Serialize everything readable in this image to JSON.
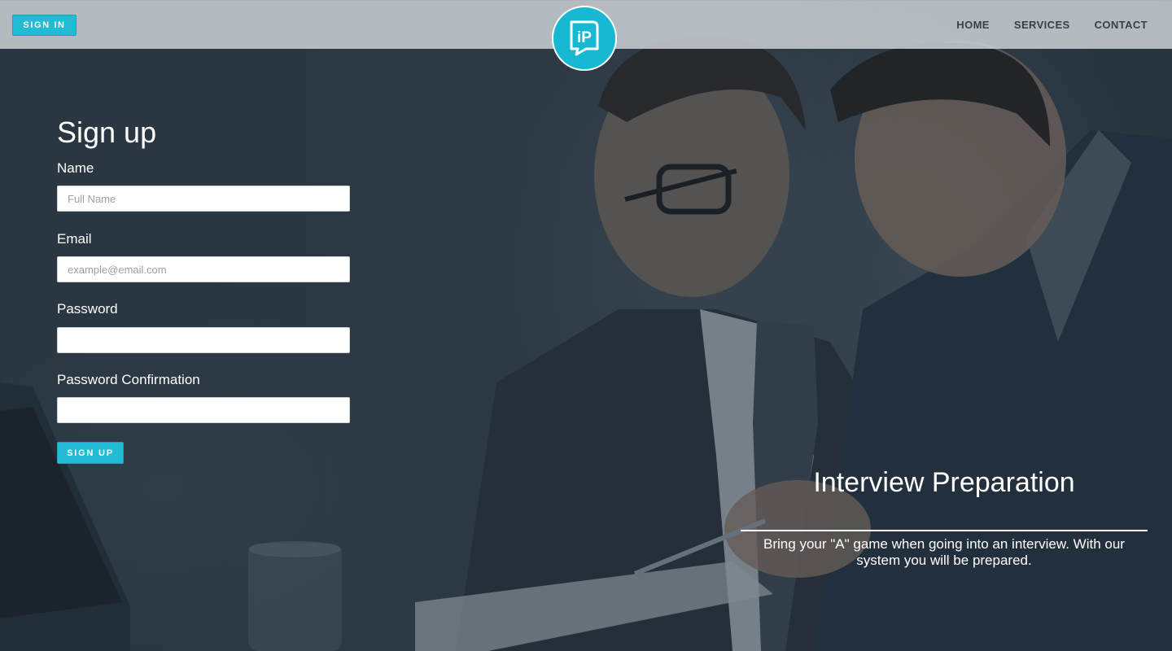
{
  "header": {
    "signin_label": "SIGN IN",
    "logo_text": "iP",
    "nav": [
      {
        "label": "HOME"
      },
      {
        "label": "SERVICES"
      },
      {
        "label": "CONTACT"
      }
    ]
  },
  "form": {
    "title": "Sign up",
    "fields": [
      {
        "label": "Name",
        "placeholder": "Full Name",
        "value": ""
      },
      {
        "label": "Email",
        "placeholder": "example@email.com",
        "value": ""
      },
      {
        "label": "Password",
        "placeholder": "",
        "value": ""
      },
      {
        "label": "Password Confirmation",
        "placeholder": "",
        "value": ""
      }
    ],
    "submit_label": "SIGN UP"
  },
  "hero": {
    "title": "Interview Preparation",
    "subtitle": "Bring your \"A\" game when going into an interview. With our system you will be prepared."
  },
  "colors": {
    "accent": "#21bbd4",
    "header_bg": "#cdd2d6",
    "overlay": "#23303c"
  },
  "icons": {
    "logo": "ip-logo-icon"
  }
}
